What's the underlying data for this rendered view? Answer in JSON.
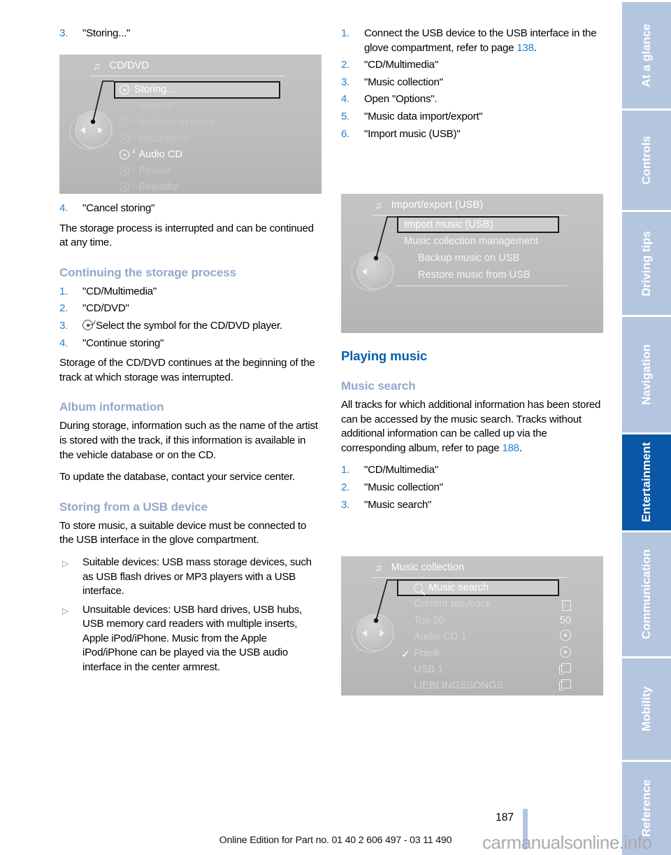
{
  "page": {
    "number": "187",
    "edition": "Online Edition for Part no. 01 40 2 606 497 - 03 11 490",
    "watermark": "carmanualsonline.info"
  },
  "rail": {
    "tabs": [
      {
        "label": "At a glance",
        "active": false
      },
      {
        "label": "Controls",
        "active": false
      },
      {
        "label": "Driving tips",
        "active": false
      },
      {
        "label": "Navigation",
        "active": false
      },
      {
        "label": "Entertainment",
        "active": true
      },
      {
        "label": "Communication",
        "active": false
      },
      {
        "label": "Mobility",
        "active": false
      },
      {
        "label": "Reference",
        "active": false
      }
    ],
    "active_color": "#0a57a5",
    "inactive_color": "#b4c5e0"
  },
  "left_column": {
    "step3_num": "3.",
    "step3_text": "\"Storing...\"",
    "screen1": {
      "title": "CD/DVD",
      "rows": [
        {
          "label": "Storing...",
          "sup": "",
          "state": "selected"
        },
        {
          "label": "Best off",
          "sup": "1",
          "state": "dim"
        },
        {
          "label": "Brothers in arms",
          "sup": "2",
          "state": "dim"
        },
        {
          "label": "Mezzanine",
          "sup": "3",
          "state": "dim"
        },
        {
          "label": "Audio CD",
          "sup": "4",
          "state": "bright"
        },
        {
          "label": "Reload",
          "sup": "5",
          "state": "dim"
        },
        {
          "label": "Beautiful",
          "sup": "6",
          "state": "dim"
        }
      ]
    },
    "step4_num": "4.",
    "step4_text": "\"Cancel storing\"",
    "para_interrupted": "The storage process is interrupted and can be continued at any time.",
    "heading_continuing": "Continuing the storage process",
    "continuing_steps": [
      {
        "num": "1.",
        "text": "\"CD/Multimedia\""
      },
      {
        "num": "2.",
        "text": "\"CD/DVD\""
      },
      {
        "num": "3.",
        "text": "Select the symbol for the CD/DVD player.",
        "has_cd_icon": true
      },
      {
        "num": "4.",
        "text": "\"Continue storing\""
      }
    ],
    "para_storage_continues": "Storage of the CD/DVD continues at the beginning of the track at which storage was interrupted.",
    "heading_album": "Album information",
    "para_album_1": "During storage, information such as the name of the artist is stored with the track, if this information is available in the vehicle database or on the CD.",
    "para_album_2": "To update the database, contact your service center.",
    "heading_usb": "Storing from a USB device",
    "para_usb": "To store music, a suitable device must be connected to the USB interface in the glove compartment.",
    "bullets": [
      "Suitable devices: USB mass storage devices, such as USB flash drives or MP3 players with a USB interface.",
      "Unsuitable devices: USB hard drives, USB hubs, USB memory card readers with multiple inserts, Apple iPod/iPhone. Music from the Apple iPod/iPhone can be played via the USB audio interface in the center armrest."
    ]
  },
  "right_column": {
    "usb_steps": [
      {
        "num": "1.",
        "text_before": "Connect the USB device to the USB interface in the glove compartment, refer to page ",
        "page_ref": "138",
        "text_after": "."
      },
      {
        "num": "2.",
        "text": "\"CD/Multimedia\""
      },
      {
        "num": "3.",
        "text": "\"Music collection\""
      },
      {
        "num": "4.",
        "text": "Open \"Options\"."
      },
      {
        "num": "5.",
        "text": "\"Music data import/export\""
      },
      {
        "num": "6.",
        "text": "\"Import music (USB)\""
      }
    ],
    "screen2": {
      "title": "Import/export (USB)",
      "rows": [
        {
          "label": "Import music (USB)",
          "state": "selected"
        },
        {
          "label": "Music collection management",
          "state": "normal"
        },
        {
          "label": "Backup music on USB",
          "state": "normal"
        },
        {
          "label": "Restore music from USB",
          "state": "normal"
        }
      ]
    },
    "heading_playing": "Playing music",
    "heading_search": "Music search",
    "para_search_before": "All tracks for which additional information has been stored can be accessed by the music search. Tracks without additional information can be called up via the corresponding album, refer to page ",
    "para_search_ref": "188",
    "para_search_after": ".",
    "search_steps": [
      {
        "num": "1.",
        "text": "\"CD/Multimedia\""
      },
      {
        "num": "2.",
        "text": "\"Music collection\""
      },
      {
        "num": "3.",
        "text": "\"Music search\""
      }
    ],
    "screen3": {
      "title": "Music collection",
      "rows": [
        {
          "label": "Music search",
          "icon": "",
          "state": "selected",
          "check": false
        },
        {
          "label": "Current playback",
          "icon": "info-note",
          "state": "normal",
          "check": false
        },
        {
          "label": "Top 50",
          "icon": "50",
          "state": "normal",
          "check": false
        },
        {
          "label": "Audio-CD 1",
          "icon": "disc",
          "state": "normal",
          "check": false
        },
        {
          "label": "Frank",
          "icon": "disc",
          "state": "normal",
          "check": true
        },
        {
          "label": "USB 1",
          "icon": "folder",
          "state": "normal",
          "check": false
        },
        {
          "label": "LIEBLINGSSONGS",
          "icon": "folder",
          "state": "normal",
          "check": false
        }
      ]
    }
  },
  "colors": {
    "h1": "#0a5ea8",
    "h2": "#90a8cb",
    "step_number": "#2d7fc4",
    "page_ref": "#2d7fc4",
    "screen_bg": "#bdbebe"
  }
}
